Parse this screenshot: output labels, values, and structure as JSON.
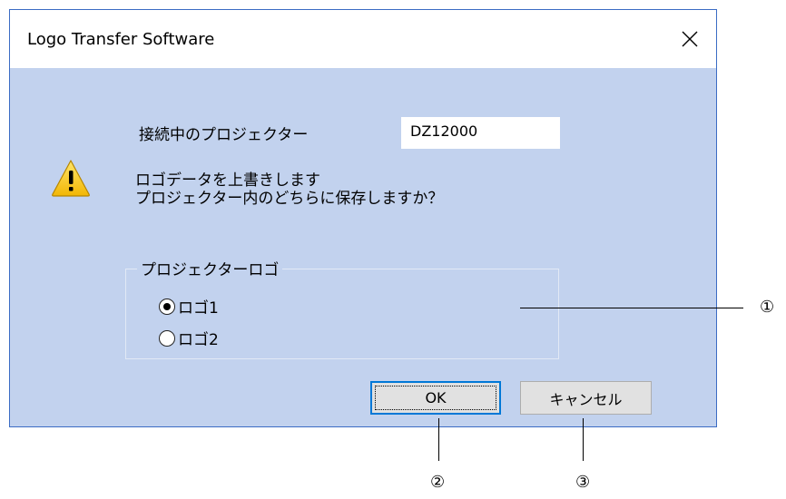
{
  "window": {
    "title": "Logo Transfer Software"
  },
  "dialog": {
    "projector_label": "接続中のプロジェクター",
    "projector_model": "DZ12000",
    "message_line1": "ロゴデータを上書きします",
    "message_line2": "プロジェクター内のどちらに保存しますか？",
    "group_label": "プロジェクターロゴ",
    "options": [
      {
        "label": "ロゴ1",
        "selected": true
      },
      {
        "label": "ロゴ2",
        "selected": false
      }
    ],
    "ok_label": "OK",
    "cancel_label": "キャンセル"
  },
  "callouts": {
    "c1": "①",
    "c2": "②",
    "c3": "③"
  },
  "colors": {
    "client_bg": "#c2d2ee",
    "window_border": "#3b6cc4",
    "ok_border": "#0078d7"
  },
  "icons": {
    "close": "close-icon",
    "warning": "warning-icon"
  }
}
